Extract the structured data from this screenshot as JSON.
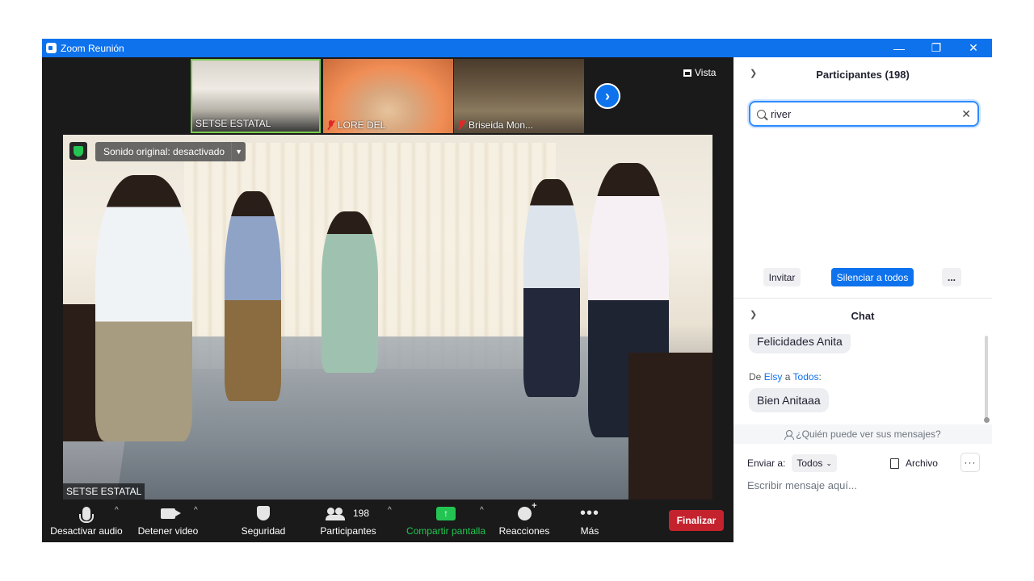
{
  "window": {
    "title": "Zoom Reunión",
    "controls": [
      "—",
      "❐",
      "✕"
    ]
  },
  "thumbnails": [
    {
      "name": "SETSE ESTATAL",
      "muted": false,
      "active": true
    },
    {
      "name": "LORE DEL",
      "muted": true,
      "active": false
    },
    {
      "name": "Briseida Mon...",
      "muted": true,
      "active": false
    }
  ],
  "view_button": "Vista",
  "main_video": {
    "sound_label": "Sonido original: desactivado",
    "speaker_name": "SETSE ESTATAL"
  },
  "toolbar": {
    "mute": "Desactivar audio",
    "video": "Detener video",
    "security": "Seguridad",
    "participants": "Participantes",
    "participants_count": "198",
    "share": "Compartir pantalla",
    "reactions": "Reacciones",
    "more": "Más",
    "end": "Finalizar"
  },
  "participants_panel": {
    "title": "Participantes (198)",
    "search_value": "river",
    "invite": "Invitar",
    "mute_all": "Silenciar a todos",
    "more": "..."
  },
  "chat_panel": {
    "title": "Chat",
    "messages": [
      {
        "text": "Felicidades Anita"
      },
      {
        "from_prefix": "De",
        "from": "Elsy",
        "to_prefix": "a",
        "to": "Todos",
        "colon": ":",
        "text": "Bien Anitaaa"
      }
    ],
    "who_can_see": "¿Quién puede ver sus mensajes?",
    "send_to_label": "Enviar a:",
    "send_to_value": "Todos",
    "file_button": "Archivo",
    "input_placeholder": "Escribir mensaje aquí..."
  },
  "colors": {
    "zoom_blue": "#0e72ed",
    "share_green": "#23c552",
    "end_red": "#c4232d",
    "active_border": "#7acb4a"
  }
}
